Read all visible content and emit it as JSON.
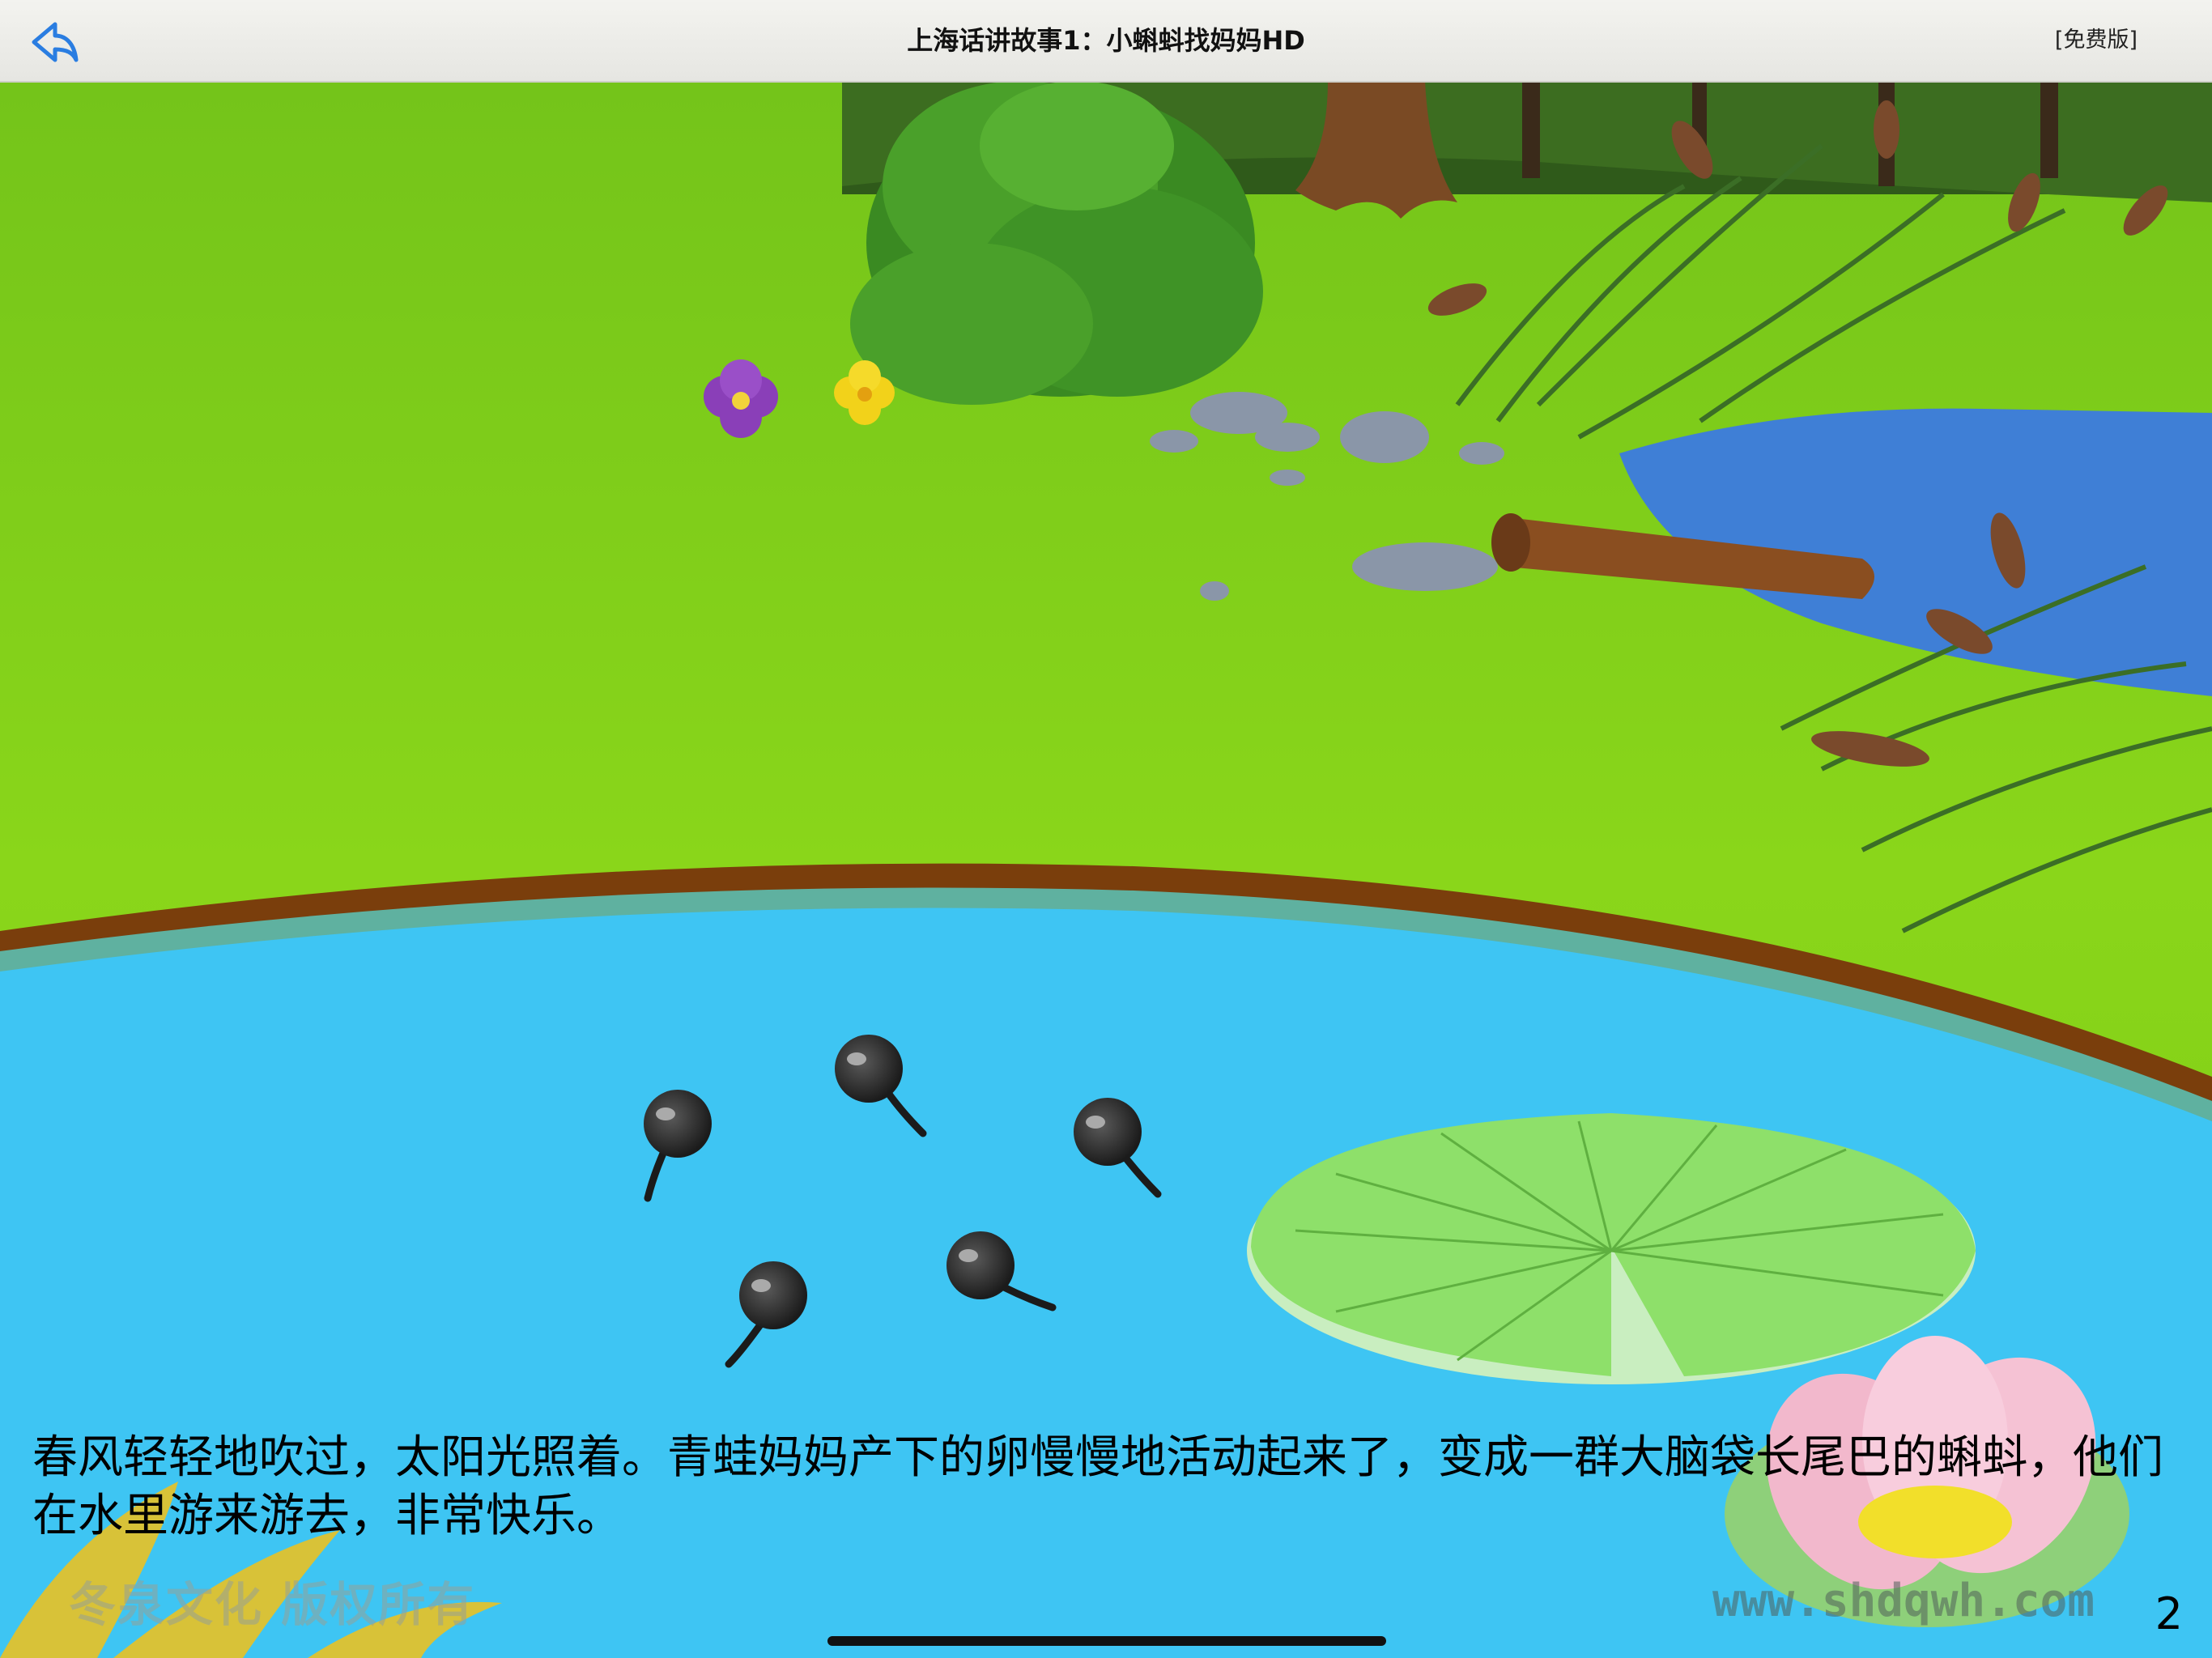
{
  "nav": {
    "title": "上海话讲故事1：小蝌蚪找妈妈HD",
    "edition": "[免费版]",
    "back_icon": "back-arrow-icon"
  },
  "story": {
    "text": "春风轻轻地吹过，太阳光照着。青蛙妈妈产下的卵慢慢地活动起来了，变成一群大脑袋长尾巴的蝌蚪，他们在水里游来游去，非常快乐。"
  },
  "watermarks": {
    "copyright": "冬泉文化 版权所有",
    "website": "www.shdqwh.com"
  },
  "page_number": "2",
  "colors": {
    "grass": "#86d018",
    "pond": "#3ec5f3",
    "pond_rim": "#7a3e0c",
    "lily_pad": "#8ee06a",
    "tadpole": "#222222"
  }
}
